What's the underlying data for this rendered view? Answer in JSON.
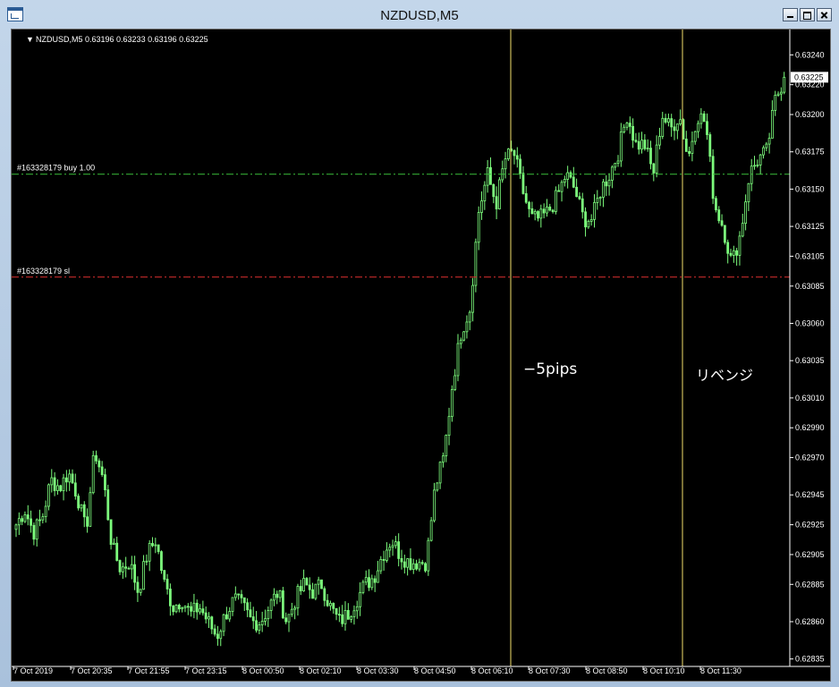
{
  "window": {
    "title": "NZDUSD,M5"
  },
  "chart_header": "NZDUSD,M5  0.63196 0.63233 0.63196 0.63225",
  "price_axis_labels": [
    "0.63240",
    "0.63220",
    "0.63200",
    "0.63175",
    "0.63150",
    "0.63125",
    "0.63105",
    "0.63085",
    "0.63060",
    "0.63035",
    "0.63010",
    "0.62990",
    "0.62970",
    "0.62945",
    "0.62925",
    "0.62905",
    "0.62885",
    "0.62860",
    "0.62835"
  ],
  "current_price": "0.63225",
  "time_axis_labels": [
    "7 Oct 2019",
    "7 Oct 20:35",
    "7 Oct 21:55",
    "7 Oct 23:15",
    "8 Oct 00:50",
    "8 Oct 02:10",
    "8 Oct 03:30",
    "8 Oct 04:50",
    "8 Oct 06:10",
    "8 Oct 07:30",
    "8 Oct 08:50",
    "8 Oct 10:10",
    "8 Oct 11:30"
  ],
  "order_lines": [
    {
      "label": "#163328179 buy 1.00",
      "price": 0.6316,
      "color": "#3bbf3b"
    },
    {
      "label": "#163328179 sl",
      "price": 0.63091,
      "color": "#e03030"
    }
  ],
  "annotations": [
    {
      "text": "−5pips",
      "color": "#ffffff"
    },
    {
      "text": "リベンジ",
      "color": "#ffffff"
    }
  ],
  "colors": {
    "background": "#000000",
    "candles": "#7cfc7c",
    "vline": "#f5df6b",
    "text": "#ffffff"
  },
  "chart_data": {
    "type": "candlestick",
    "symbol": "NZDUSD",
    "timeframe": "M5",
    "ylim": [
      0.6283,
      0.63245
    ],
    "close_path": [
      0.62925,
      0.62935,
      0.6292,
      0.6293,
      0.62955,
      0.6295,
      0.6296,
      0.62945,
      0.6292,
      0.62975,
      0.62955,
      0.6291,
      0.62895,
      0.629,
      0.6288,
      0.62905,
      0.62915,
      0.62885,
      0.6287,
      0.62875,
      0.62865,
      0.6287,
      0.6286,
      0.6285,
      0.62865,
      0.62875,
      0.6287,
      0.6286,
      0.6286,
      0.6287,
      0.6288,
      0.6286,
      0.62875,
      0.62885,
      0.6288,
      0.62885,
      0.6287,
      0.6286,
      0.62865,
      0.62875,
      0.62885,
      0.6289,
      0.62905,
      0.62915,
      0.62905,
      0.629,
      0.629,
      0.629,
      0.6295,
      0.6297,
      0.6302,
      0.63055,
      0.6307,
      0.63135,
      0.6316,
      0.6314,
      0.6317,
      0.63175,
      0.6315,
      0.6313,
      0.6313,
      0.63135,
      0.63145,
      0.6316,
      0.6315,
      0.6313,
      0.6313,
      0.6315,
      0.6316,
      0.63175,
      0.632,
      0.6318,
      0.6318,
      0.6316,
      0.632,
      0.6319,
      0.632,
      0.6317,
      0.632,
      0.63195,
      0.6314,
      0.63125,
      0.631,
      0.6312,
      0.6316,
      0.6317,
      0.63175,
      0.6321,
      0.63225
    ]
  }
}
